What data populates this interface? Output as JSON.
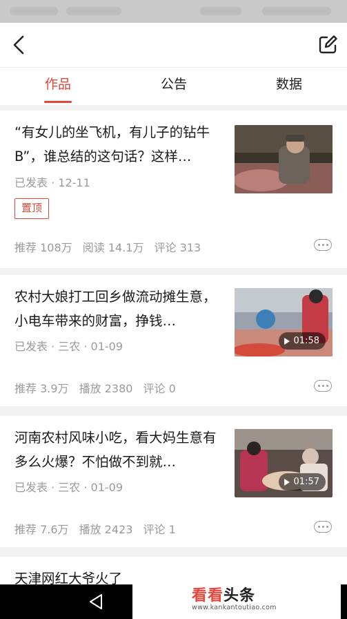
{
  "tabs": [
    {
      "label": "作品",
      "active": true
    },
    {
      "label": "公告",
      "active": false
    },
    {
      "label": "数据",
      "active": false
    }
  ],
  "articles": [
    {
      "title": "“有女儿的坐飞机，有儿子的钻牛B”，谁总结的这句话？这样…",
      "meta": "已发表 · 12-11",
      "tag": "置顶",
      "stats": [
        "推荐 108万",
        "阅读 14.1万",
        "评论 313"
      ]
    },
    {
      "title": "农村大娘打工回乡做流动摊生意，小电车带来的财富，挣钱…",
      "meta": "已发表 · 三农 · 01-09",
      "duration": "01:58",
      "stats": [
        "推荐 3.9万",
        "播放 2380",
        "评论 0"
      ]
    },
    {
      "title": "河南农村风味小吃，看大妈生意有多么火爆？不怕做不到就…",
      "meta": "已发表 · 三农 · 01-09",
      "duration": "01:57",
      "stats": [
        "推荐 7.6万",
        "播放 2423",
        "评论 1"
      ]
    },
    {
      "title": "天津网红大爷火了"
    }
  ],
  "watermark": {
    "main_a": "看看",
    "main_b": "头条",
    "url": "www.kankantoutiao.com"
  },
  "icons": {
    "back": "chevron-left-icon",
    "edit": "edit-icon",
    "more": "more-dots-icon",
    "play": "play-icon",
    "nav_back": "triangle-back-icon"
  },
  "colors": {
    "accent": "#e1463a",
    "meta_text": "#9a9a9a"
  }
}
